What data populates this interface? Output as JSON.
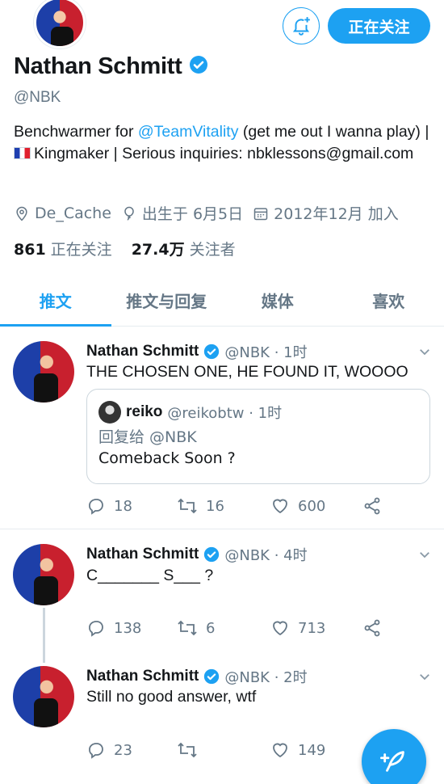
{
  "profile": {
    "name": "Nathan Schmitt",
    "handle": "@NBK",
    "follow_label": "正在关注",
    "bio_prefix": "Benchwarmer for ",
    "bio_link": "@TeamVitality",
    "bio_mid": " (get me out I wanna play) | ",
    "bio_suffix": "Kingmaker | Serious inquiries: nbklessons@gmail.com",
    "location": "De_Cache",
    "birthday": "出生于 6月5日",
    "joined": "2012年12月 加入",
    "following_count": "861",
    "following_label": "正在关注",
    "followers_count": "27.4万",
    "followers_label": "关注者"
  },
  "tabs": [
    {
      "label": "推文",
      "active": true
    },
    {
      "label": "推文与回复",
      "active": false
    },
    {
      "label": "媒体",
      "active": false
    },
    {
      "label": "喜欢",
      "active": false
    }
  ],
  "tweets": [
    {
      "name": "Nathan Schmitt",
      "handle_time": "@NBK · 1时",
      "text": "THE CHOSEN ONE, HE FOUND IT, WOOOO",
      "quote": {
        "name": "reiko",
        "handle_time": "@reikobtw · 1时",
        "reply_to": "回复给 @NBK",
        "text": "Comeback Soon ?"
      },
      "replies": "18",
      "retweets": "16",
      "likes": "600"
    },
    {
      "name": "Nathan Schmitt",
      "handle_time": "@NBK · 4时",
      "text": "C_______ S___ ?",
      "replies": "138",
      "retweets": "6",
      "likes": "713"
    },
    {
      "name": "Nathan Schmitt",
      "handle_time": "@NBK · 2时",
      "text": "Still no good answer, wtf",
      "replies": "23",
      "retweets": "",
      "likes": "149"
    }
  ],
  "colors": {
    "accent": "#1da1f2",
    "text": "#14171a",
    "muted": "#657786",
    "border": "#e6ecf0"
  },
  "icons": [
    "bell-plus-icon",
    "verified-badge-icon",
    "location-icon",
    "balloon-icon",
    "calendar-icon",
    "reply-icon",
    "retweet-icon",
    "like-icon",
    "share-icon",
    "chevron-down-icon",
    "compose-icon"
  ]
}
